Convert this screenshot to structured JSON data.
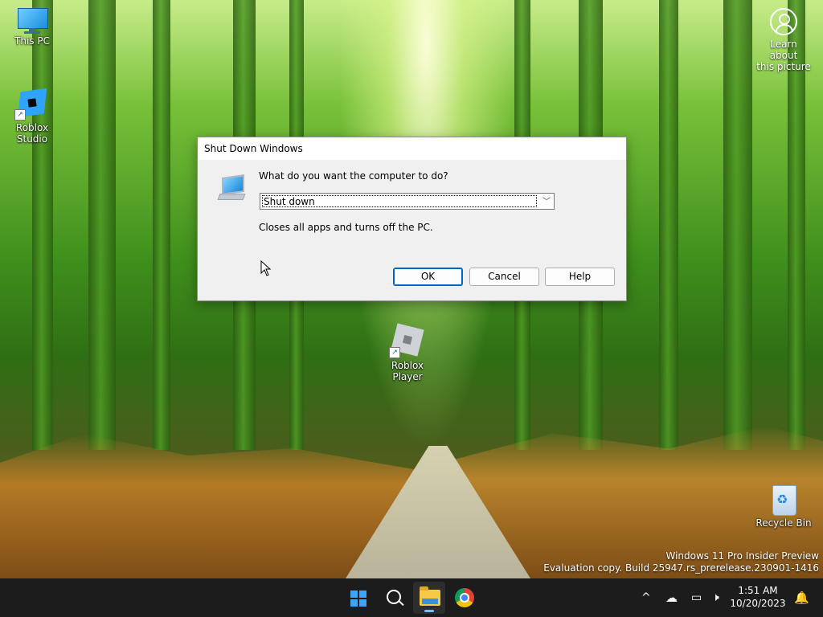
{
  "desktop": {
    "icons": [
      {
        "label": "This PC",
        "icon": "monitor-icon"
      },
      {
        "label": "Roblox Studio",
        "icon": "roblox-studio-icon"
      },
      {
        "label": "Roblox Player",
        "icon": "roblox-player-icon"
      },
      {
        "label": "Recycle Bin",
        "icon": "recycle-bin-icon"
      }
    ],
    "learn_about": {
      "line1": "Learn about",
      "line2": "this picture",
      "icon": "camera-info-icon"
    },
    "watermark": {
      "line1": "Windows 11 Pro Insider Preview",
      "line2": "Evaluation copy. Build 25947.rs_prerelease.230901-1416"
    }
  },
  "dialog": {
    "title": "Shut Down Windows",
    "question": "What do you want the computer to do?",
    "selected_option": "Shut down",
    "description": "Closes all apps and turns off the PC.",
    "buttons": {
      "ok": "OK",
      "cancel": "Cancel",
      "help": "Help"
    },
    "icon": "computer-icon"
  },
  "taskbar": {
    "apps": [
      {
        "name": "Start",
        "icon": "windows-logo-icon"
      },
      {
        "name": "Search",
        "icon": "search-icon"
      },
      {
        "name": "File Explorer",
        "icon": "folder-icon",
        "running": true
      },
      {
        "name": "Google Chrome",
        "icon": "chrome-icon"
      }
    ],
    "tray": {
      "chevron": "^",
      "time": "1:51 AM",
      "date": "10/20/2023",
      "icons": [
        "show-hidden-icons-icon",
        "onedrive-icon",
        "network-icon",
        "volume-muted-icon",
        "notification-bell-icon"
      ]
    }
  },
  "colors": {
    "accent": "#0067c0",
    "taskbar": "#1c1c1c",
    "dialog_bg": "#f0f0f0"
  }
}
